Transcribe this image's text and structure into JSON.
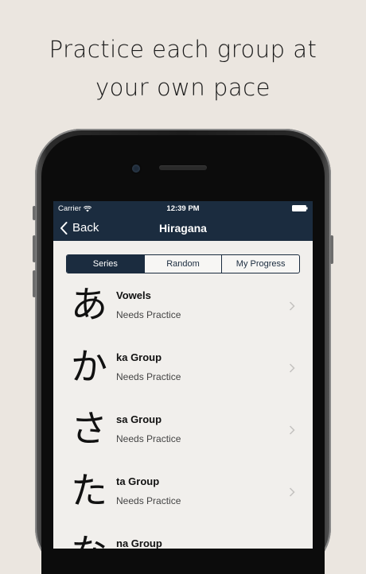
{
  "headline": {
    "line1": "Practice each group at",
    "line2": "your own pace"
  },
  "status_bar": {
    "carrier": "Carrier",
    "time": "12:39 PM"
  },
  "nav": {
    "back_label": "Back",
    "title": "Hiragana"
  },
  "segments": {
    "series": "Series",
    "random": "Random",
    "progress": "My Progress",
    "selected": "Series"
  },
  "groups": [
    {
      "kana": "あ",
      "name": "Vowels",
      "status": "Needs Practice"
    },
    {
      "kana": "か",
      "name": "ka Group",
      "status": "Needs Practice"
    },
    {
      "kana": "さ",
      "name": "sa Group",
      "status": "Needs Practice"
    },
    {
      "kana": "た",
      "name": "ta Group",
      "status": "Needs Practice"
    },
    {
      "kana": "な",
      "name": "na Group",
      "status": ""
    }
  ],
  "colors": {
    "background": "#ebe6e0",
    "nav_bar": "#1b2c3f",
    "screen": "#f1efec"
  }
}
